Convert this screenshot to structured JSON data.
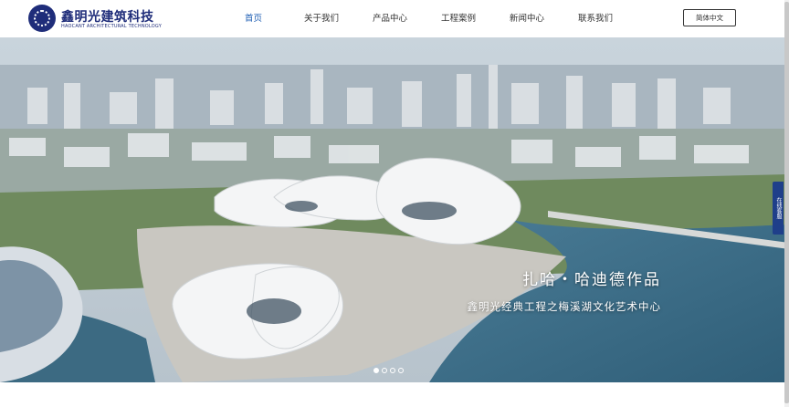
{
  "logo": {
    "cn": "鑫明光建筑科技",
    "en": "HAOCANT ARCHITECTURAL TECHNOLOGY"
  },
  "nav": {
    "items": [
      "首页",
      "关于我们",
      "产品中心",
      "工程案例",
      "新闻中心",
      "联系我们"
    ],
    "active_index": 0,
    "lang_button": "简体中文"
  },
  "banner": {
    "title": "扎哈・哈迪德作品",
    "subtitle": "鑫明光经典工程之梅溪湖文化艺术中心",
    "slides_total": 4,
    "active_slide": 1
  },
  "side_tab": {
    "label": "在线客服"
  },
  "colors": {
    "brand": "#1f2d7a",
    "active_nav": "#1f5fb4"
  },
  "icons": {
    "logo": "logo-emblem-icon"
  }
}
